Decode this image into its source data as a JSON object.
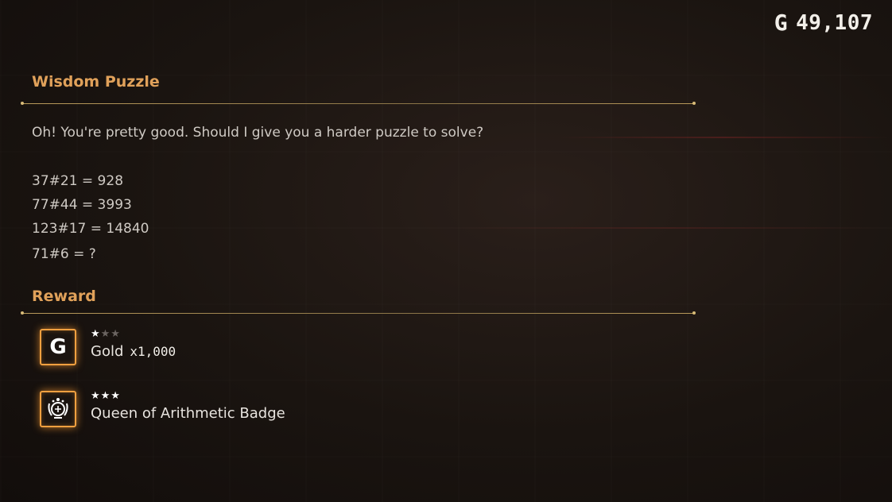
{
  "currency": {
    "icon": "G",
    "amount": "49,107"
  },
  "puzzle": {
    "title": "Wisdom Puzzle",
    "description": "Oh! You're pretty good. Should I give you a harder puzzle to solve?",
    "equations": [
      "37#21 = 928",
      "77#44 = 3993",
      "123#17 = 14840",
      "71#6 = ?"
    ]
  },
  "reward": {
    "title": "Reward",
    "items": [
      {
        "icon": "gold-coin-icon",
        "icon_glyph": "G",
        "stars": 1,
        "stars_max": 3,
        "name": "Gold",
        "quantity": "x1,000"
      },
      {
        "icon": "badge-icon",
        "stars": 3,
        "stars_max": 3,
        "name": "Queen of Arithmetic Badge",
        "quantity": ""
      }
    ]
  },
  "colors": {
    "accent": "#e0a15a",
    "icon_glow": "#f0a040",
    "divider": "#b99a5a"
  }
}
